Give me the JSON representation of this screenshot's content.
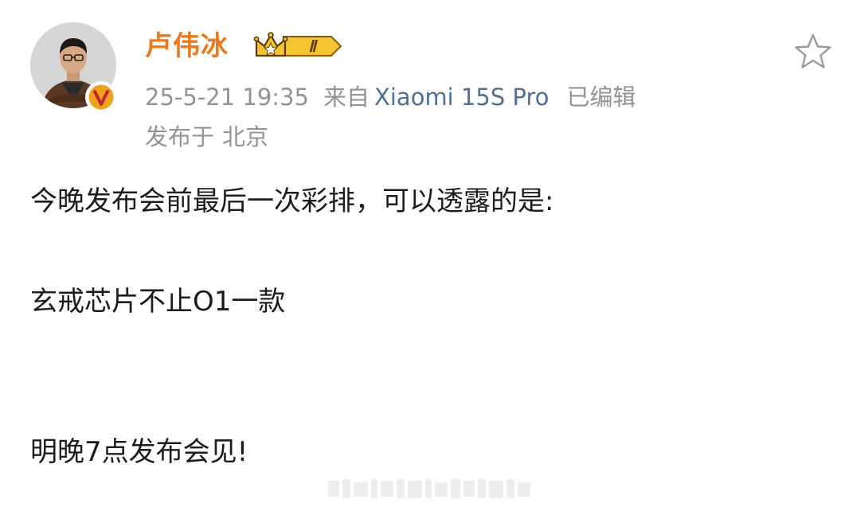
{
  "user": {
    "name": "卢伟冰",
    "vip_level": "Ⅱ",
    "avatar_icon": "user-avatar",
    "verified_icon": "verified-v-icon",
    "verified_color": "#f0a21d",
    "name_color": "#eb7a1a"
  },
  "meta": {
    "datetime": "25-5-21 19:35",
    "source_prefix": "来自",
    "device": "Xiaomi 15S Pro",
    "edited": "已编辑",
    "location_prefix": "发布于",
    "location": "北京",
    "device_color": "#4e6f96"
  },
  "actions": {
    "favorite_icon": "star-outline-icon"
  },
  "post": {
    "lines": [
      "今晚发布会前最后一次彩排，可以透露的是:",
      "玄戒芯片不止O1一款",
      "明晚7点发布会见!"
    ]
  }
}
